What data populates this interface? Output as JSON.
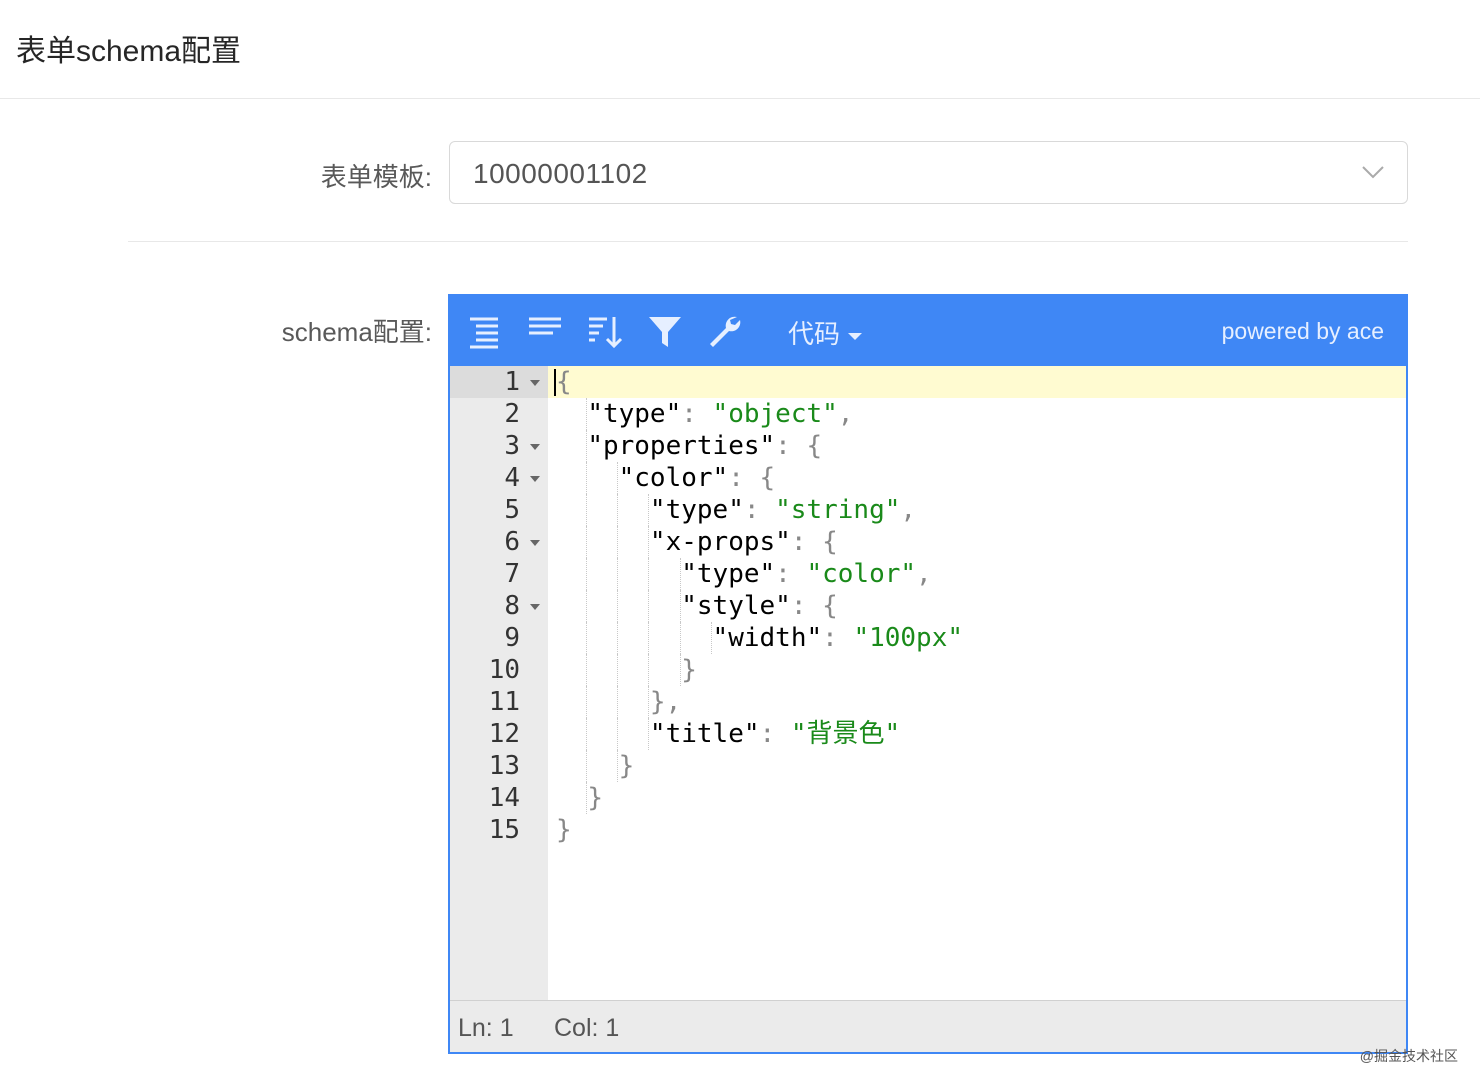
{
  "header": {
    "title": "表单schema配置"
  },
  "form": {
    "template_label": "表单模板:",
    "template_value": "10000001102",
    "schema_label": "schema配置:"
  },
  "editor": {
    "toolbar": {
      "icons": [
        "format-icon",
        "compact-icon",
        "sort-icon",
        "filter-icon",
        "repair-icon"
      ],
      "mode_label": "代码",
      "powered_by": "powered by ace"
    },
    "lines": [
      {
        "num": "1",
        "fold": true
      },
      {
        "num": "2",
        "fold": false
      },
      {
        "num": "3",
        "fold": true
      },
      {
        "num": "4",
        "fold": true
      },
      {
        "num": "5",
        "fold": false
      },
      {
        "num": "6",
        "fold": true
      },
      {
        "num": "7",
        "fold": false
      },
      {
        "num": "8",
        "fold": true
      },
      {
        "num": "9",
        "fold": false
      },
      {
        "num": "10",
        "fold": false
      },
      {
        "num": "11",
        "fold": false
      },
      {
        "num": "12",
        "fold": false
      },
      {
        "num": "13",
        "fold": false
      },
      {
        "num": "14",
        "fold": false
      },
      {
        "num": "15",
        "fold": false
      }
    ],
    "code": [
      [
        {
          "t": "punc",
          "v": "{"
        }
      ],
      [
        {
          "t": "sp",
          "v": "  "
        },
        {
          "t": "key",
          "v": "\"type\""
        },
        {
          "t": "punc",
          "v": ": "
        },
        {
          "t": "str",
          "v": "\"object\""
        },
        {
          "t": "punc",
          "v": ","
        }
      ],
      [
        {
          "t": "sp",
          "v": "  "
        },
        {
          "t": "key",
          "v": "\"properties\""
        },
        {
          "t": "punc",
          "v": ": {"
        }
      ],
      [
        {
          "t": "sp",
          "v": "    "
        },
        {
          "t": "key",
          "v": "\"color\""
        },
        {
          "t": "punc",
          "v": ": {"
        }
      ],
      [
        {
          "t": "sp",
          "v": "      "
        },
        {
          "t": "key",
          "v": "\"type\""
        },
        {
          "t": "punc",
          "v": ": "
        },
        {
          "t": "str",
          "v": "\"string\""
        },
        {
          "t": "punc",
          "v": ","
        }
      ],
      [
        {
          "t": "sp",
          "v": "      "
        },
        {
          "t": "key",
          "v": "\"x-props\""
        },
        {
          "t": "punc",
          "v": ": {"
        }
      ],
      [
        {
          "t": "sp",
          "v": "        "
        },
        {
          "t": "key",
          "v": "\"type\""
        },
        {
          "t": "punc",
          "v": ": "
        },
        {
          "t": "str",
          "v": "\"color\""
        },
        {
          "t": "punc",
          "v": ","
        }
      ],
      [
        {
          "t": "sp",
          "v": "        "
        },
        {
          "t": "key",
          "v": "\"style\""
        },
        {
          "t": "punc",
          "v": ": {"
        }
      ],
      [
        {
          "t": "sp",
          "v": "          "
        },
        {
          "t": "key",
          "v": "\"width\""
        },
        {
          "t": "punc",
          "v": ": "
        },
        {
          "t": "str",
          "v": "\"100px\""
        }
      ],
      [
        {
          "t": "sp",
          "v": "        "
        },
        {
          "t": "punc",
          "v": "}"
        }
      ],
      [
        {
          "t": "sp",
          "v": "      "
        },
        {
          "t": "punc",
          "v": "},"
        }
      ],
      [
        {
          "t": "sp",
          "v": "      "
        },
        {
          "t": "key",
          "v": "\"title\""
        },
        {
          "t": "punc",
          "v": ": "
        },
        {
          "t": "str",
          "v": "\"背景色\""
        }
      ],
      [
        {
          "t": "sp",
          "v": "    "
        },
        {
          "t": "punc",
          "v": "}"
        }
      ],
      [
        {
          "t": "sp",
          "v": "  "
        },
        {
          "t": "punc",
          "v": "}"
        }
      ],
      [
        {
          "t": "punc",
          "v": "}"
        }
      ]
    ],
    "status": {
      "ln": "Ln: 1",
      "col": "Col: 1"
    }
  },
  "watermark": "@掘金技术社区",
  "colors": {
    "accent": "#3f87f5",
    "string": "#1a8a1a",
    "active_line": "#fffbd1"
  }
}
